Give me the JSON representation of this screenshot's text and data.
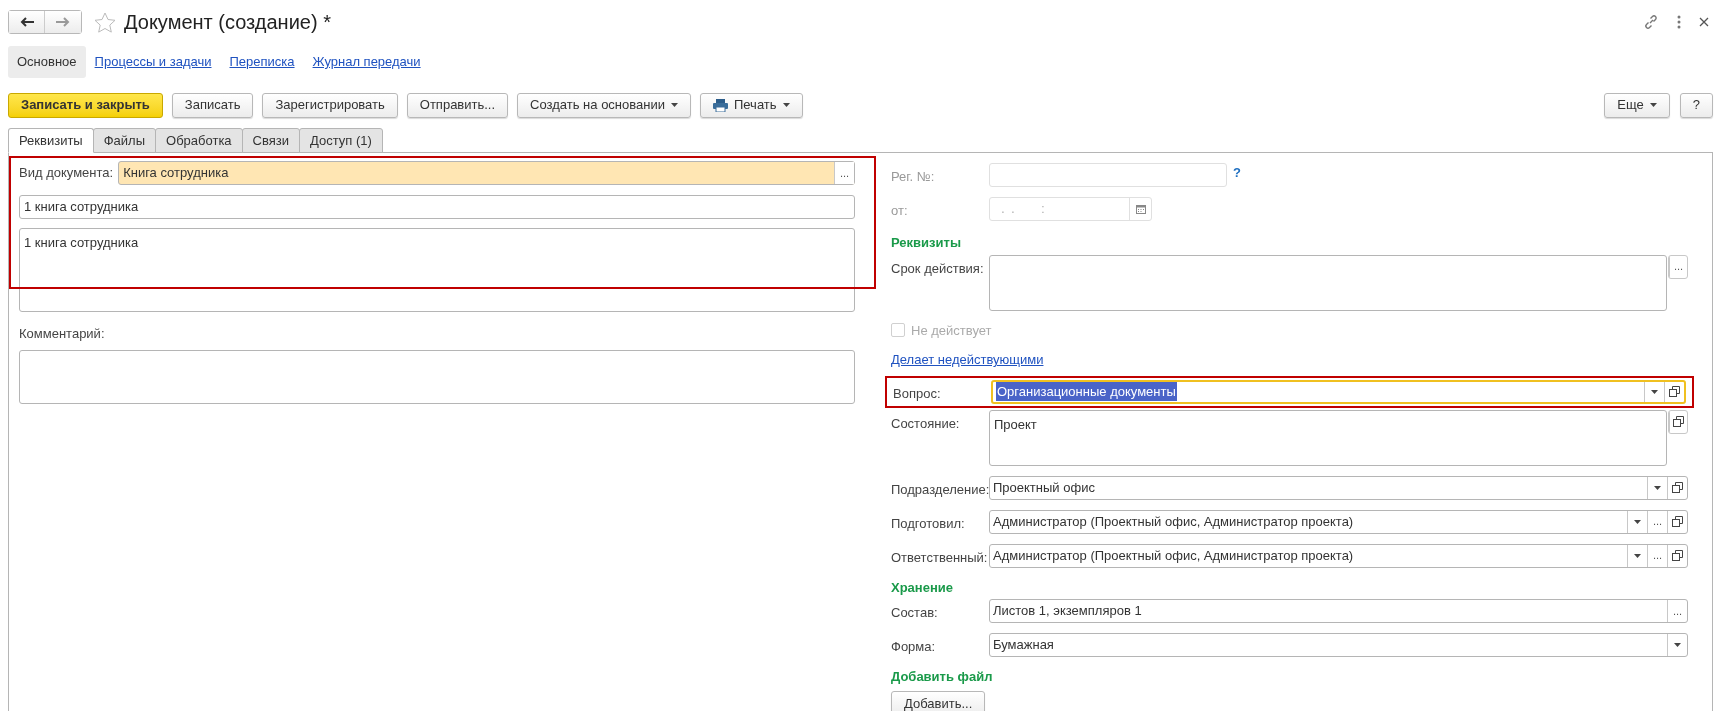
{
  "header": {
    "title": "Документ (создание) *"
  },
  "nav": [
    {
      "label": "Основное",
      "selected": true
    },
    {
      "label": "Процессы и задачи",
      "selected": false
    },
    {
      "label": "Переписка",
      "selected": false
    },
    {
      "label": "Журнал передачи",
      "selected": false
    }
  ],
  "toolbar": {
    "buttons": [
      {
        "label": "Записать и закрыть",
        "kind": "primary"
      },
      {
        "label": "Записать",
        "kind": "plain"
      },
      {
        "label": "Зарегистрировать",
        "kind": "plain"
      },
      {
        "label": "Отправить...",
        "kind": "plain"
      },
      {
        "label": "Создать на основании",
        "kind": "menu"
      },
      {
        "label": "Печать",
        "kind": "print"
      }
    ],
    "right_buttons": [
      {
        "label": "Еще",
        "kind": "menu"
      },
      {
        "label": "?",
        "kind": "plain"
      }
    ]
  },
  "tabs": [
    {
      "label": "Реквизиты",
      "selected": true
    },
    {
      "label": "Файлы",
      "selected": false
    },
    {
      "label": "Обработка",
      "selected": false
    },
    {
      "label": "Связи",
      "selected": false
    },
    {
      "label": "Доступ (1)",
      "selected": false
    }
  ],
  "left": {
    "highlighted": true,
    "doc_type": {
      "label": "Вид документа:",
      "value": "Книга сотрудника",
      "choose": "..."
    },
    "title_value": "1 книга сотрудника",
    "content_value": "1 книга сотрудника",
    "comment_label": "Комментарий:"
  },
  "right": [
    {
      "kind": "text",
      "label": "Рег. №:",
      "disabled": true,
      "help": "?"
    },
    {
      "kind": "date",
      "label": "от:",
      "disabled": true,
      "mask": " .  .        :"
    },
    {
      "kind": "heading",
      "label": "Реквизиты"
    },
    {
      "kind": "area",
      "label": "Срок действия:",
      "buttons": [
        {
          "kind": "choose",
          "label": "..."
        }
      ]
    },
    {
      "kind": "checkbox",
      "label": "Не действует",
      "checked": false,
      "disabled": true
    },
    {
      "kind": "link",
      "label": "Делает недействующими"
    },
    {
      "kind": "field",
      "label": "Вопрос:",
      "value": "Организационные документы",
      "highlighted": true,
      "focused": true,
      "buttons": [
        {
          "kind": "dropdown"
        },
        {
          "kind": "open"
        }
      ]
    },
    {
      "kind": "area",
      "label": "Состояние:",
      "value": "Проект",
      "buttons": [
        {
          "kind": "open"
        }
      ]
    },
    {
      "kind": "field",
      "label": "Подразделение:",
      "value": "Проектный офис",
      "highlighted": false,
      "focused": false,
      "buttons": [
        {
          "kind": "dropdown"
        },
        {
          "kind": "open"
        }
      ]
    },
    {
      "kind": "field",
      "label": "Подготовил:",
      "value": "Администратор (Проектный офис, Администратор проекта)",
      "highlighted": false,
      "focused": false,
      "buttons": [
        {
          "kind": "dropdown"
        },
        {
          "kind": "choose",
          "label": "..."
        },
        {
          "kind": "open"
        }
      ]
    },
    {
      "kind": "field",
      "label": "Ответственный:",
      "value": "Администратор (Проектный офис, Администратор проекта)",
      "highlighted": false,
      "focused": false,
      "buttons": [
        {
          "kind": "dropdown"
        },
        {
          "kind": "choose",
          "label": "..."
        },
        {
          "kind": "open"
        }
      ]
    },
    {
      "kind": "heading",
      "label": "Хранение"
    },
    {
      "kind": "field",
      "label": "Состав:",
      "value": "Листов 1, экземпляров 1",
      "highlighted": false,
      "focused": false,
      "buttons": [
        {
          "kind": "choose",
          "label": "..."
        }
      ]
    },
    {
      "kind": "field",
      "label": "Форма:",
      "value": "Бумажная",
      "highlighted": false,
      "focused": false,
      "buttons": [
        {
          "kind": "dropdown"
        }
      ]
    },
    {
      "kind": "heading",
      "label": "Добавить файл"
    },
    {
      "kind": "button",
      "label": "Добавить..."
    }
  ]
}
